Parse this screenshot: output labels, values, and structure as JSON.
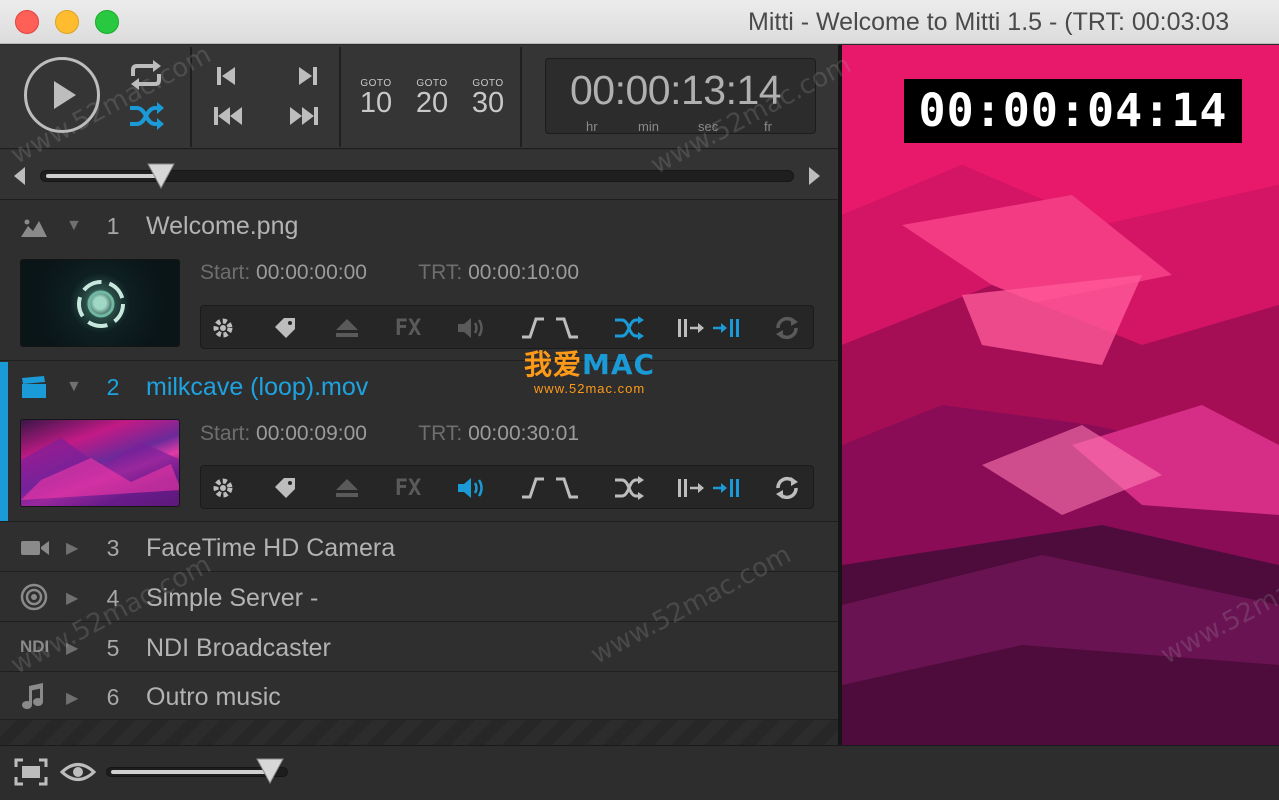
{
  "window": {
    "title": "Mitti - Welcome to Mitti 1.5 - (TRT: 00:03:03"
  },
  "transport": {
    "play_icon": "play-icon",
    "loop_icon": "loop-icon",
    "shuffle_icon": "shuffle-icon",
    "goto": [
      {
        "label": "GOTO",
        "value": "10"
      },
      {
        "label": "GOTO",
        "value": "20"
      },
      {
        "label": "GOTO",
        "value": "30"
      }
    ],
    "timecode": {
      "value": "00:00:13:14",
      "units": [
        "hr",
        "min",
        "sec",
        "fr"
      ]
    }
  },
  "scrubber": {
    "position": 0.16
  },
  "cues": [
    {
      "number": "1",
      "name": "Welcome.png",
      "type_icon": "image-icon",
      "expanded": true,
      "start_label": "Start:",
      "start": "00:00:00:00",
      "trt_label": "TRT:",
      "trt": "00:00:10:00"
    },
    {
      "number": "2",
      "name": "milkcave (loop).mov",
      "type_icon": "video-clapper-icon",
      "expanded": true,
      "active": true,
      "start_label": "Start:",
      "start": "00:00:09:00",
      "trt_label": "TRT:",
      "trt": "00:00:30:01"
    },
    {
      "number": "3",
      "name": "FaceTime HD Camera",
      "type_icon": "camera-icon"
    },
    {
      "number": "4",
      "name": "Simple Server -",
      "type_icon": "server-icon"
    },
    {
      "number": "5",
      "name": "NDI Broadcaster",
      "type_icon": "ndi-icon",
      "type_text": "NDI"
    },
    {
      "number": "6",
      "name": "Outro music",
      "type_icon": "music-note-icon"
    }
  ],
  "cue_toolbar": {
    "fx_label": "FX"
  },
  "preview": {
    "timecode": "00:00:04:14"
  },
  "bottom": {
    "volume": 0.9
  },
  "watermark": {
    "cn": "我爱",
    "mac": "MAC",
    "url": "www.52mac.com",
    "diag": "www.52mac.com"
  },
  "colors": {
    "accent": "#1a9bd7",
    "preview_pink": "#e0135f"
  }
}
